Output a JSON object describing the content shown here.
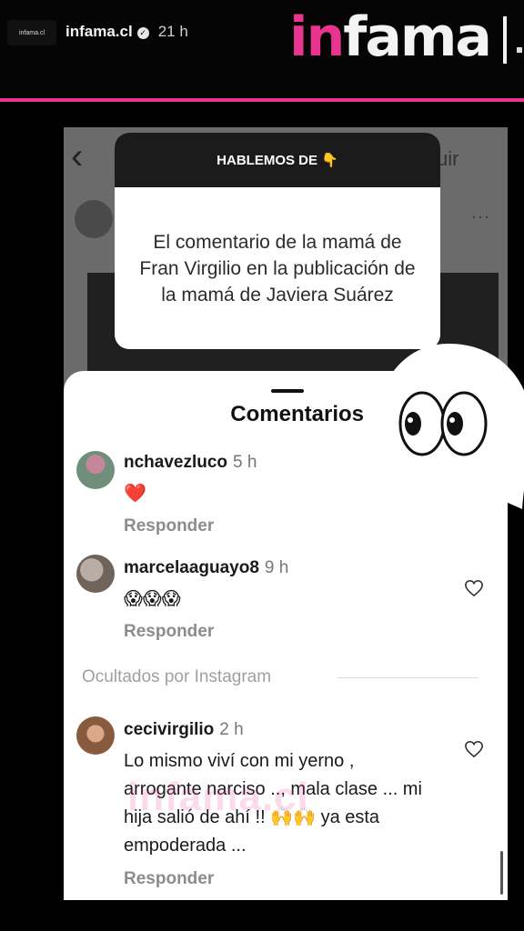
{
  "header": {
    "avatar_label": "infama.cl",
    "handle": "infama.cl",
    "verified_glyph": "✓",
    "time": "21 h",
    "brand_part1": "in",
    "brand_part2": "fama",
    "accent_color": "#e8348f"
  },
  "background_post": {
    "back_icon": "chevron-left-icon",
    "back_glyph": "‹",
    "partial_text": "uir",
    "more_glyph": "···"
  },
  "question_card": {
    "header": "HABLEMOS DE 👇",
    "body": "El comentario de la mamá de Fran Virgilio en la publicación de la mamá de Javiera Suárez"
  },
  "comments_sheet": {
    "title": "Comentarios",
    "reply_label": "Responder",
    "hidden_label": "Ocultados por Instagram",
    "comments": [
      {
        "user": "nchavezluco",
        "time": "5 h",
        "text": "❤️",
        "has_like": false
      },
      {
        "user": "marcelaaguayo8",
        "time": "9 h",
        "text": "😱😱😱",
        "has_like": true
      },
      {
        "user": "cecivirgilio",
        "time": "2 h",
        "text": "Lo mismo viví con mi yerno , arrogante narciso .., mala clase ... mi hija salió de ahí !! 🙌🙌 ya esta empoderada ...",
        "has_like": true
      }
    ]
  },
  "watermark": "infama.cl",
  "bubble_icon": "eyes-icon"
}
